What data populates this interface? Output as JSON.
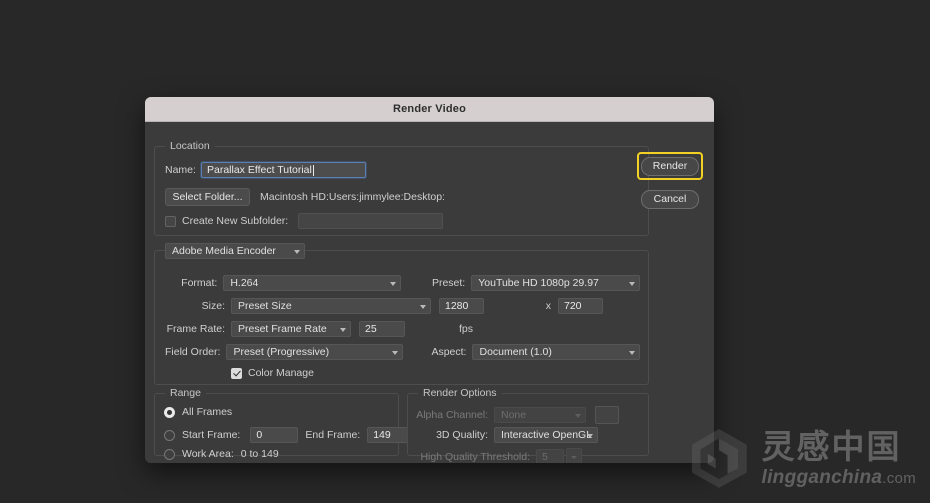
{
  "window": {
    "title": "Render Video"
  },
  "location": {
    "legend": "Location",
    "name_label": "Name:",
    "name_value": "Parallax Effect Tutorial",
    "select_folder_label": "Select Folder...",
    "folder_path": "Macintosh HD:Users:jimmylee:Desktop:",
    "create_subfolder_label": "Create New Subfolder:",
    "create_subfolder_checked": false,
    "subfolder_value": ""
  },
  "buttons": {
    "render_label": "Render",
    "cancel_label": "Cancel",
    "render_highlight_color": "#f2d024"
  },
  "encoder": {
    "engine": "Adobe Media Encoder",
    "format_label": "Format:",
    "format_value": "H.264",
    "preset_label": "Preset:",
    "preset_value": "YouTube HD 1080p 29.97",
    "size_label": "Size:",
    "size_value": "Preset Size",
    "width_value": "1280",
    "x_label": "x",
    "height_value": "720",
    "frame_rate_label": "Frame Rate:",
    "frame_rate_value": "Preset Frame Rate",
    "fps_value": "25",
    "fps_unit": "fps",
    "field_order_label": "Field Order:",
    "field_order_value": "Preset (Progressive)",
    "aspect_label": "Aspect:",
    "aspect_value": "Document (1.0)",
    "color_manage_label": "Color Manage",
    "color_manage_checked": true
  },
  "range": {
    "legend": "Range",
    "all_frames_label": "All Frames",
    "all_frames_selected": true,
    "start_frame_label": "Start Frame:",
    "start_frame_value": "0",
    "end_frame_label": "End Frame:",
    "end_frame_value": "149",
    "work_area_label": "Work Area:",
    "work_area_value": "0 to 149"
  },
  "render_options": {
    "legend": "Render Options",
    "alpha_channel_label": "Alpha Channel:",
    "alpha_channel_value": "None",
    "quality_3d_label": "3D Quality:",
    "quality_3d_value": "Interactive OpenGL",
    "hq_threshold_label": "High Quality Threshold:",
    "hq_threshold_value": "5"
  },
  "watermark": {
    "chinese": "灵感中国",
    "latin": "lingganchina",
    "domain": ".com"
  }
}
